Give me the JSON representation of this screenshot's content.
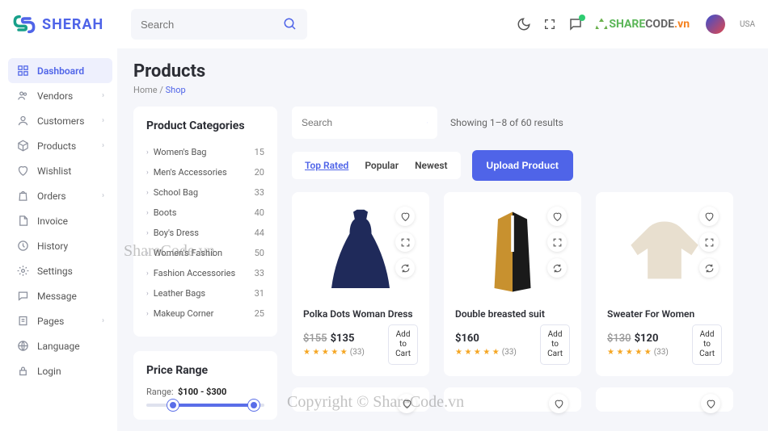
{
  "header": {
    "brand": "SHERAH",
    "search_placeholder": "Search",
    "usa_label": "USA",
    "sharecode": {
      "s1": "SHARE",
      "s2": "CODE",
      "s3": ".vn"
    }
  },
  "sidebar": [
    {
      "icon": "grid",
      "label": "Dashboard",
      "active": true,
      "chev": false
    },
    {
      "icon": "users",
      "label": "Vendors",
      "chev": true
    },
    {
      "icon": "user",
      "label": "Customers",
      "chev": true
    },
    {
      "icon": "box",
      "label": "Products",
      "chev": true
    },
    {
      "icon": "heart",
      "label": "Wishlist",
      "chev": false
    },
    {
      "icon": "bag",
      "label": "Orders",
      "chev": true
    },
    {
      "icon": "file",
      "label": "Invoice",
      "chev": false
    },
    {
      "icon": "history",
      "label": "History",
      "chev": false
    },
    {
      "icon": "gear",
      "label": "Settings",
      "chev": false
    },
    {
      "icon": "message",
      "label": "Message",
      "chev": false
    },
    {
      "icon": "pages",
      "label": "Pages",
      "chev": true
    },
    {
      "icon": "lang",
      "label": "Language",
      "chev": false
    },
    {
      "icon": "lock",
      "label": "Login",
      "chev": false
    }
  ],
  "page": {
    "title": "Products",
    "breadcrumb_home": "Home",
    "breadcrumb_sep": " / ",
    "breadcrumb_current": "Shop"
  },
  "categories": {
    "title": "Product Categories",
    "items": [
      {
        "label": "Women's Bag",
        "count": 15
      },
      {
        "label": "Men's Accessories",
        "count": 20
      },
      {
        "label": "School Bag",
        "count": 33
      },
      {
        "label": "Boots",
        "count": 40
      },
      {
        "label": "Boy's Dress",
        "count": 44
      },
      {
        "label": "Women's Fashion",
        "count": 50
      },
      {
        "label": "Fashion Accessories",
        "count": 33
      },
      {
        "label": "Leather Bags",
        "count": 31
      },
      {
        "label": "Makeup Corner",
        "count": 25
      }
    ]
  },
  "priceRange": {
    "title": "Price Range",
    "label_prefix": "Range:",
    "value": "$100 - $300"
  },
  "filter": {
    "search_placeholder": "Search",
    "results_text": "Showing 1–8 of 60 results",
    "tabs": [
      "Top Rated",
      "Popular",
      "Newest"
    ],
    "active_tab": 0,
    "upload_label": "Upload Product"
  },
  "products": [
    {
      "title": "Polka Dots Woman Dress",
      "old_price": "$155",
      "price": "$135",
      "rating_count": "(33)",
      "add_label": "Add to Cart",
      "svg": "dress"
    },
    {
      "title": "Double breasted suit",
      "old_price": "",
      "price": "$160",
      "rating_count": "(33)",
      "add_label": "Add to Cart",
      "svg": "suit"
    },
    {
      "title": "Sweater For Women",
      "old_price": "$130",
      "price": "$120",
      "rating_count": "(33)",
      "add_label": "Add to Cart",
      "svg": "sweater"
    }
  ],
  "stars_text": "★ ★ ★ ★ ★",
  "watermarks": {
    "wm1": "ShareCode.vn",
    "wm2": "Copyright © ShareCode.vn"
  }
}
